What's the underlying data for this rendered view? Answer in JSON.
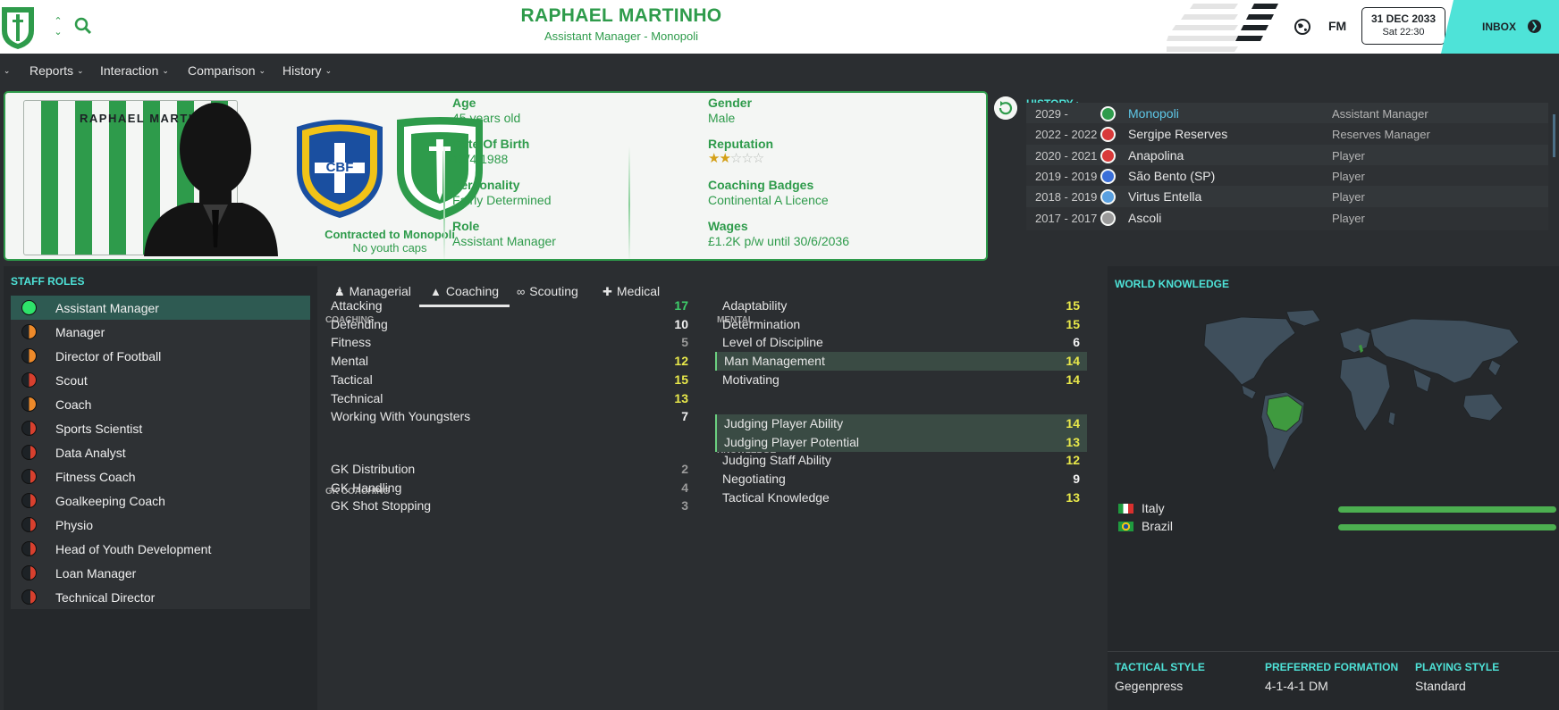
{
  "header": {
    "person_name": "RAPHAEL MARTINHO",
    "subtitle": "Assistant Manager - Monopoli",
    "brand": "FM",
    "date": "31 DEC 2033",
    "time": "Sat 22:30",
    "inbox_label": "INBOX"
  },
  "nav": [
    "Reports",
    "Interaction",
    "Comparison",
    "History"
  ],
  "profile": {
    "kit_name": "RAPHAEL MARTINHO",
    "nation_badge_text": "CBF",
    "contract_line": "Contracted to Monopoli",
    "youth_line": "No youth caps",
    "fields": [
      {
        "label": "Age",
        "value": "45 years old"
      },
      {
        "label": "Date Of Birth",
        "value": "15/4/1988"
      },
      {
        "label": "Personality",
        "value": "Fairly Determined"
      },
      {
        "label": "Role",
        "value": "Assistant Manager"
      },
      {
        "label": "Gender",
        "value": "Male"
      },
      {
        "label": "Reputation",
        "value": ""
      },
      {
        "label": "Coaching Badges",
        "value": "Continental A Licence"
      },
      {
        "label": "Wages",
        "value": "£1.2K p/w until 30/6/2036"
      }
    ],
    "reputation_stars": 2,
    "reputation_max": 5
  },
  "history": {
    "title": "HISTORY",
    "rows": [
      {
        "years": "2029 -",
        "club": "Monopoli",
        "role": "Assistant Manager",
        "icon_color": "#2e9b4b",
        "current": true
      },
      {
        "years": "2022 - 2022",
        "club": "Sergipe Reserves",
        "role": "Reserves Manager",
        "icon_color": "#d83a3a",
        "current": false
      },
      {
        "years": "2020 - 2021",
        "club": "Anapolina",
        "role": "Player",
        "icon_color": "#d83a3a",
        "current": false
      },
      {
        "years": "2019 - 2019",
        "club": "São Bento (SP)",
        "role": "Player",
        "icon_color": "#3a6fd8",
        "current": false
      },
      {
        "years": "2018 - 2019",
        "club": "Virtus Entella",
        "role": "Player",
        "icon_color": "#5aa0e0",
        "current": false
      },
      {
        "years": "2017 - 2017",
        "club": "Ascoli",
        "role": "Player",
        "icon_color": "#9a9a9a",
        "current": false
      }
    ]
  },
  "staff_roles": {
    "title": "STAFF ROLES",
    "items": [
      {
        "label": "Assistant Manager",
        "suit": "full",
        "selected": true
      },
      {
        "label": "Manager",
        "suit": "half-orange",
        "selected": false
      },
      {
        "label": "Director of Football",
        "suit": "half-orange",
        "selected": false
      },
      {
        "label": "Scout",
        "suit": "half-red",
        "selected": false
      },
      {
        "label": "Coach",
        "suit": "half-orange",
        "selected": false
      },
      {
        "label": "Sports Scientist",
        "suit": "low",
        "selected": false
      },
      {
        "label": "Data Analyst",
        "suit": "low",
        "selected": false
      },
      {
        "label": "Fitness Coach",
        "suit": "low",
        "selected": false
      },
      {
        "label": "Goalkeeping Coach",
        "suit": "low",
        "selected": false
      },
      {
        "label": "Physio",
        "suit": "low",
        "selected": false
      },
      {
        "label": "Head of Youth Development",
        "suit": "low",
        "selected": false
      },
      {
        "label": "Loan Manager",
        "suit": "low",
        "selected": false
      },
      {
        "label": "Technical Director",
        "suit": "low",
        "selected": false
      }
    ]
  },
  "tabs": [
    {
      "label": "Managerial",
      "icon": "person-icon",
      "active": false
    },
    {
      "label": "Coaching",
      "icon": "cone-icon",
      "active": true
    },
    {
      "label": "Scouting",
      "icon": "binoculars-icon",
      "active": false
    },
    {
      "label": "Medical",
      "icon": "medkit-icon",
      "active": false
    }
  ],
  "attributes": {
    "coaching_title": "COACHING",
    "coaching": [
      {
        "name": "Attacking",
        "value": 17,
        "color": "g"
      },
      {
        "name": "Defending",
        "value": 10,
        "color": "w"
      },
      {
        "name": "Fitness",
        "value": 5,
        "color": "gr"
      },
      {
        "name": "Mental",
        "value": 12,
        "color": "y"
      },
      {
        "name": "Tactical",
        "value": 15,
        "color": "y"
      },
      {
        "name": "Technical",
        "value": 13,
        "color": "y"
      },
      {
        "name": "Working With Youngsters",
        "value": 7,
        "color": "w"
      }
    ],
    "gk_title": "GK COACHING",
    "gk": [
      {
        "name": "GK Distribution",
        "value": 2,
        "color": "gr"
      },
      {
        "name": "GK Handling",
        "value": 4,
        "color": "gr"
      },
      {
        "name": "GK Shot Stopping",
        "value": 3,
        "color": "gr"
      }
    ],
    "mental_title": "MENTAL",
    "mental": [
      {
        "name": "Adaptability",
        "value": 15,
        "color": "y",
        "hl": false
      },
      {
        "name": "Determination",
        "value": 15,
        "color": "y",
        "hl": false
      },
      {
        "name": "Level of Discipline",
        "value": 6,
        "color": "w",
        "hl": false
      },
      {
        "name": "Man Management",
        "value": 14,
        "color": "y",
        "hl": true
      },
      {
        "name": "Motivating",
        "value": 14,
        "color": "y",
        "hl": false
      }
    ],
    "knowledge_title": "KNOWLEDGE",
    "knowledge": [
      {
        "name": "Judging Player Ability",
        "value": 14,
        "color": "y",
        "hl": true
      },
      {
        "name": "Judging Player Potential",
        "value": 13,
        "color": "y",
        "hl": true
      },
      {
        "name": "Judging Staff Ability",
        "value": 12,
        "color": "y",
        "hl": false
      },
      {
        "name": "Negotiating",
        "value": 9,
        "color": "w",
        "hl": false
      },
      {
        "name": "Tactical Knowledge",
        "value": 13,
        "color": "y",
        "hl": false
      }
    ]
  },
  "world": {
    "title": "WORLD KNOWLEDGE",
    "countries": [
      {
        "name": "Italy",
        "level": 1.0
      },
      {
        "name": "Brazil",
        "level": 1.0
      }
    ],
    "tactical_style_label": "TACTICAL STYLE",
    "tactical_style": "Gegenpress",
    "formation_label": "PREFERRED FORMATION",
    "formation": "4-1-4-1 DM",
    "playing_style_label": "PLAYING STYLE",
    "playing_style": "Standard"
  },
  "colors": {
    "accent_green": "#2e9b4b",
    "accent_teal": "#4ee3d8",
    "attr_green": "#3ecf6a",
    "attr_yellow": "#e8e84a"
  }
}
